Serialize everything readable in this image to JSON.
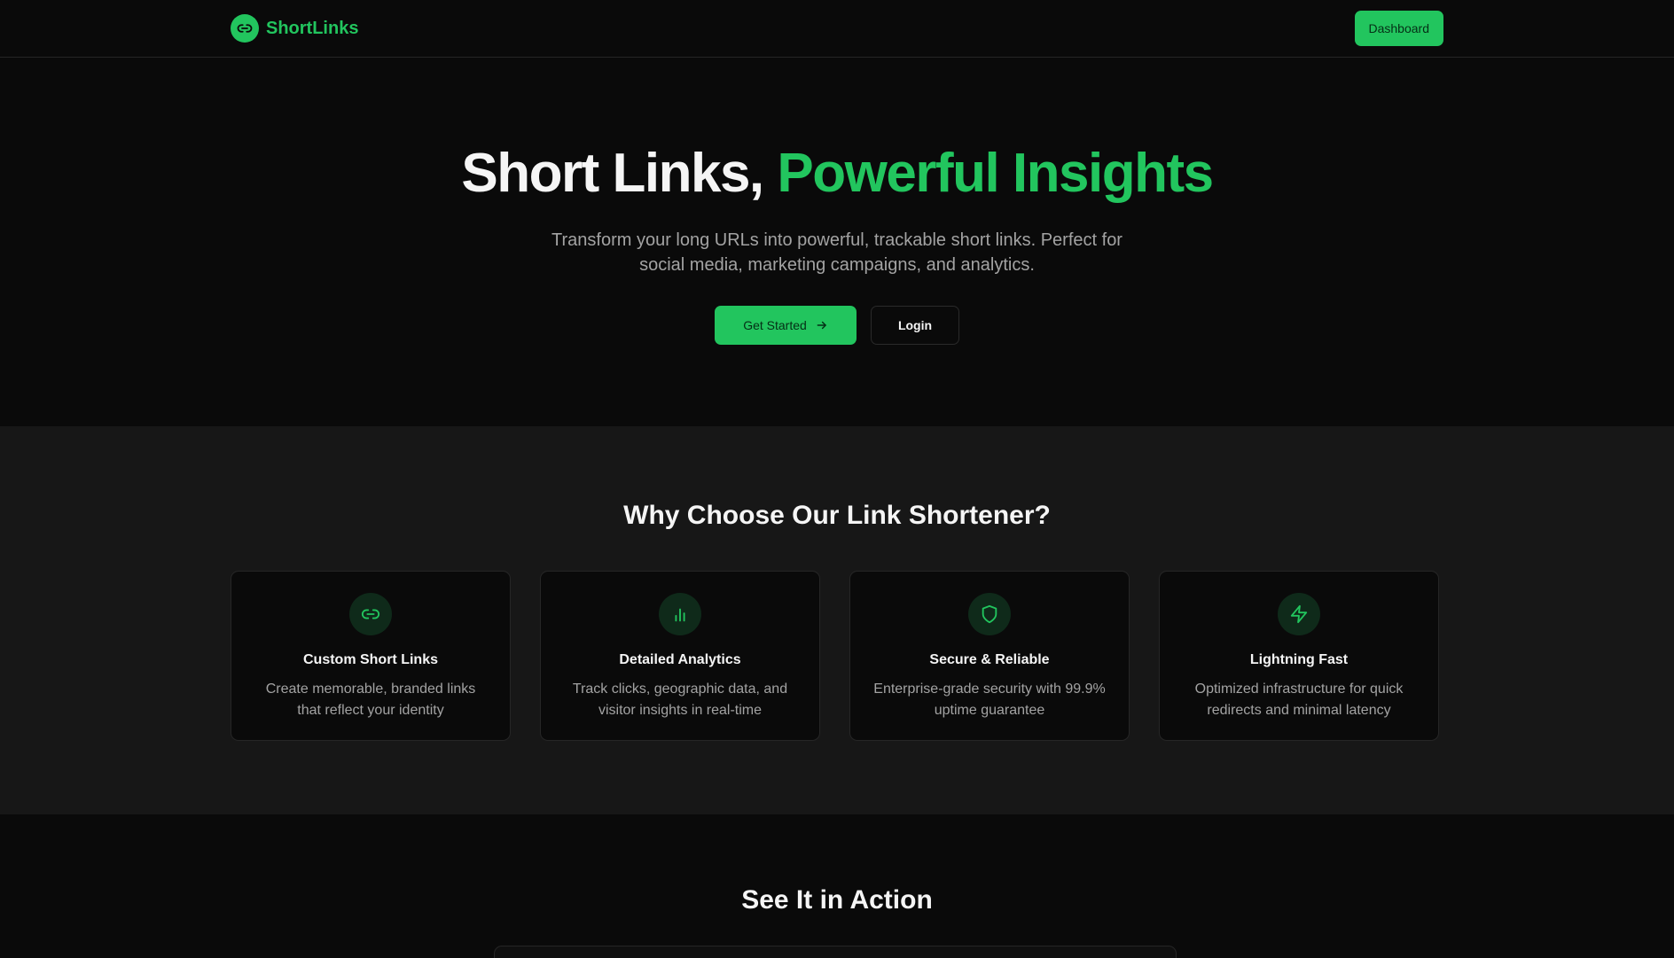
{
  "header": {
    "logo_text": "ShortLinks",
    "dashboard_label": "Dashboard"
  },
  "hero": {
    "title_part1": "Short Links,",
    "title_highlight": "Powerful Insights",
    "subtitle": "Transform your long URLs into powerful, trackable short links. Perfect for social media, marketing campaigns, and analytics.",
    "get_started_label": "Get Started",
    "login_label": "Login"
  },
  "features": {
    "title": "Why Choose Our Link Shortener?",
    "items": [
      {
        "icon": "link-icon",
        "title": "Custom Short Links",
        "description": "Create memorable, branded links that reflect your identity"
      },
      {
        "icon": "bar-chart-icon",
        "title": "Detailed Analytics",
        "description": "Track clicks, geographic data, and visitor insights in real-time"
      },
      {
        "icon": "shield-icon",
        "title": "Secure & Reliable",
        "description": "Enterprise-grade security with 99.9% uptime guarantee"
      },
      {
        "icon": "lightning-icon",
        "title": "Lightning Fast",
        "description": "Optimized infrastructure for quick redirects and minimal latency"
      }
    ]
  },
  "demo": {
    "title": "See It in Action"
  },
  "colors": {
    "accent": "#22c55e",
    "background": "#0a0a0a",
    "section_background": "#171717",
    "muted_text": "#a3a3a3"
  }
}
